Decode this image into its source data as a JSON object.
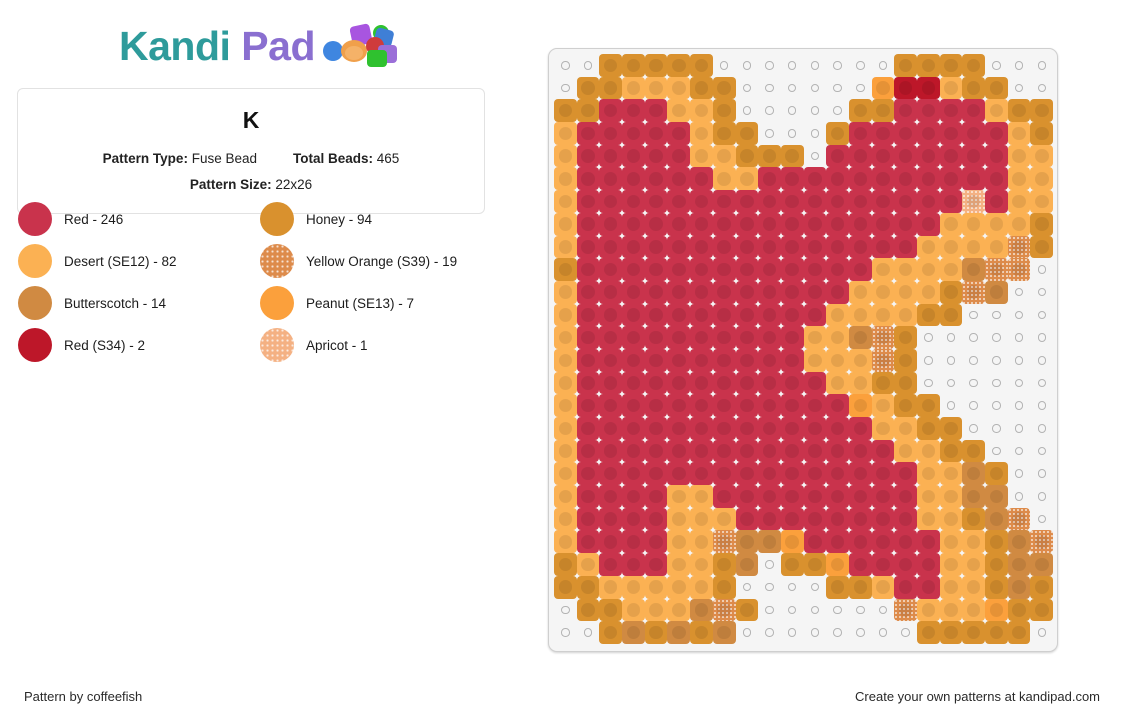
{
  "brand": {
    "name_part1": "Kandi",
    "name_part2": "Pad",
    "teal": "#2e9b9b",
    "purple": "#8a6fd0"
  },
  "info": {
    "title": "K",
    "pattern_type_label": "Pattern Type:",
    "pattern_type_value": "Fuse Bead",
    "total_beads_label": "Total Beads:",
    "total_beads_value": "465",
    "pattern_size_label": "Pattern Size:",
    "pattern_size_value": "22x26"
  },
  "legend": [
    {
      "label": "Red - 246",
      "name": "Red",
      "count": 246,
      "color": "#c9334c",
      "texture": "plain"
    },
    {
      "label": "Honey - 94",
      "name": "Honey",
      "count": 94,
      "color": "#d9912e",
      "texture": "plain"
    },
    {
      "label": "Desert (SE12) - 82",
      "name": "Desert (SE12)",
      "count": 82,
      "color": "#fbb153",
      "texture": "plain"
    },
    {
      "label": "Yellow Orange (S39) - 19",
      "name": "Yellow Orange (S39)",
      "count": 19,
      "color": "#dd8b4b",
      "texture": "speckle"
    },
    {
      "label": "Butterscotch - 14",
      "name": "Butterscotch",
      "count": 14,
      "color": "#d08a42",
      "texture": "plain"
    },
    {
      "label": "Peanut (SE13) - 7",
      "name": "Peanut (SE13)",
      "count": 7,
      "color": "#fba03c",
      "texture": "plain"
    },
    {
      "label": "Red (S34) - 2",
      "name": "Red (S34)",
      "count": 2,
      "color": "#bd1729",
      "texture": "plain"
    },
    {
      "label": "Apricot - 1",
      "name": "Apricot",
      "count": 1,
      "color": "#f4b183",
      "texture": "speckle"
    }
  ],
  "palette": {
    "R": "#c9334c",
    "H": "#d9912e",
    "D": "#fbb153",
    "Y": "#dd8b4b",
    "B": "#d08a42",
    "P": "#fba03c",
    "S": "#bd1729",
    "A": "#f4b183",
    "_": null
  },
  "speckled": [
    "Y",
    "A"
  ],
  "board": {
    "cols": 22,
    "rows": 26,
    "empty_peg_color": "#b3b3b3",
    "board_color": "#f5f5f5"
  },
  "chart_data": {
    "type": "heatmap",
    "title": "K",
    "cols": 22,
    "rows": 26,
    "legend_keys": [
      "R",
      "H",
      "D",
      "Y",
      "B",
      "P",
      "S",
      "A",
      "_"
    ],
    "grid": [
      "__HHHHH________HHHH___",
      "_HHDDDHH______PSSDHH__",
      "HHRRRDDH_____HHRRRRDHH_",
      "DRRRRRDHH___HRRRRRRRDHH",
      "DRRRRRDDHHH_RRRRRRRRDDH",
      "DRRRRRRDDRRRRRRRRRRRDDH",
      "DRRRRRRRRRRRRRRRRRARDDH",
      "DRRRRRRRRRRRRRRRRDDDDHH",
      "DRRRRRRRRRRRRRRRDDDDYHH",
      "HRRRRRRRRRRRRRDDDDBYY__",
      "DRRRRRRRRRRRRDDDDHYB___",
      "DRRRRRRRRRRRDDDDHH_____",
      "DRRRRRRRRRRDDBYH_______",
      "DRRRRRRRRRRDDDYH_______",
      "DRRRRRRRRRRRDDHH_______",
      "DRRRRRRRRRRRRPDHH______",
      "DRRRRRRRRRRRRRDDHH_____",
      "DRRRRRRRRRRRRRRDDHH____",
      "DRRRRRRRRRRRRRRRDDBH___",
      "DRRRRDDRRRRRRRRRDDBB___",
      "DRRRRDDDRRRRRRRRDDHBY__",
      "DRRRRDDYBBPRRRRRRDDHBY_",
      "HDRRRDDHB_HHPRRRRDDHBB_",
      "HHDDDDDH____HHDRRDDHBH_",
      "_HHDDDBYH______YDDDPHH_",
      "__HBHBHB________HHHHH__"
    ]
  },
  "footer": {
    "left": "Pattern by coffeefish",
    "right": "Create your own patterns at kandipad.com"
  }
}
